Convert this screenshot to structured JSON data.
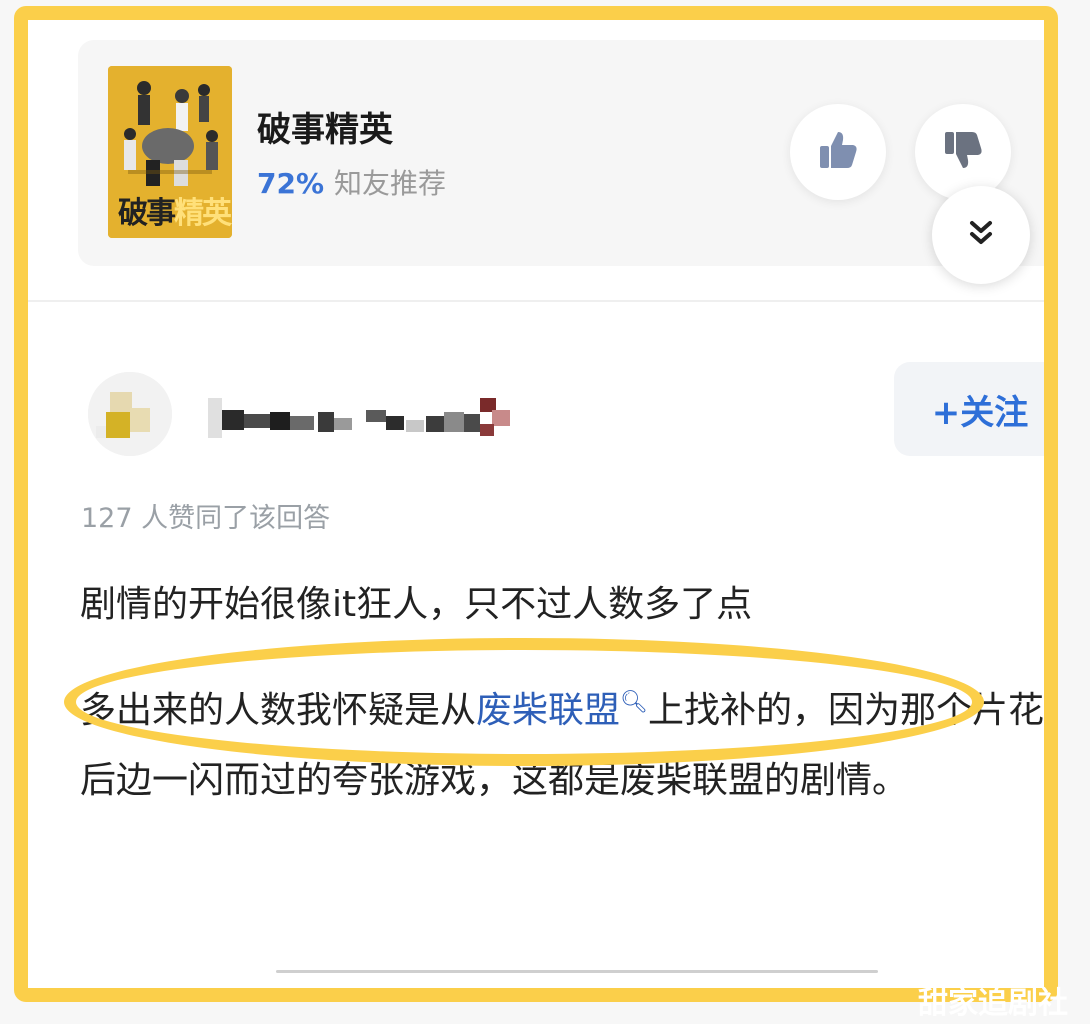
{
  "show_card": {
    "title": "破事精英",
    "rating_percent": "72%",
    "rating_label": "知友推荐",
    "poster_text_main": "破事",
    "poster_text_accent": "精英"
  },
  "icons": {
    "like": "thumbs-up-icon",
    "dislike": "thumbs-down-icon",
    "expand": "double-chevron-down-icon"
  },
  "author": {
    "follow_label": "+关注"
  },
  "answer": {
    "likes_line": "127 人赞同了该回答",
    "paragraph1": "剧情的开始很像it狂人，只不过人数多了点",
    "p2_before": "多出来的人数我怀疑是从",
    "p2_link": "废柴联盟",
    "p2_after": "上找补的，因为那个片花后边一闪而过的夸张游戏，这都是废柴联盟的剧情。"
  },
  "watermark": "甜家追剧社",
  "colors": {
    "highlight": "#fbcf4a",
    "link": "#2e5fb8",
    "rating": "#3b74d6"
  }
}
